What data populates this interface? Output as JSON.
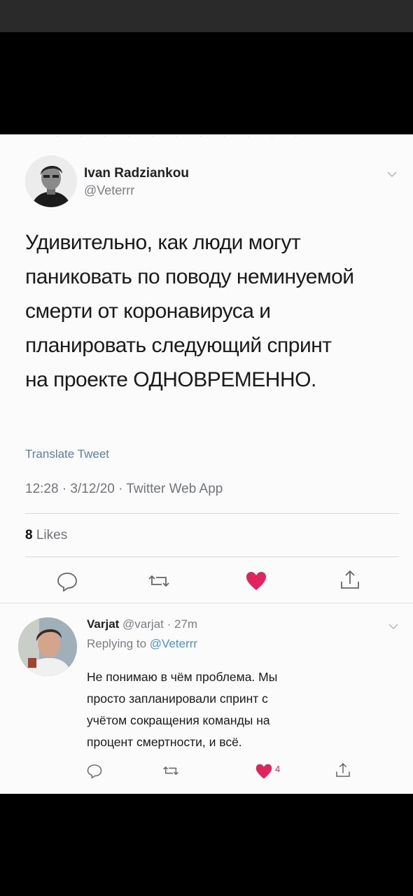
{
  "main_tweet": {
    "author_name": "Ivan Radziankou",
    "author_handle": "@Veterrr",
    "text_lines": [
      "Удивительно, как люди могут",
      "паниковать по поводу неминуемой",
      "смерти от коронавируса и",
      "планировать следующий спринт",
      "на проекте ОДНОВРЕМЕННО."
    ],
    "translate_label": "Translate Tweet",
    "meta": "12:28 · 3/12/20 · Twitter Web App",
    "likes_count": "8",
    "likes_label": "Likes",
    "colors": {
      "like": "#e0245e",
      "link": "#5c7fa3",
      "muted": "#70757a"
    },
    "icons": [
      "reply-icon",
      "retweet-icon",
      "like-icon",
      "share-icon"
    ]
  },
  "reply_tweet": {
    "author_name": "Varjat",
    "author_handle": "@varjat",
    "time": "· 27m",
    "replying_prefix": "Replying to",
    "replying_handle": "@Veterrr",
    "text_lines": [
      "Не понимаю в чём проблема. Мы",
      "просто запланировали спринт с",
      "учётом сокращения команды на",
      "процент смертности, и всё."
    ],
    "like_count": "4",
    "icons": [
      "reply-icon",
      "retweet-icon",
      "like-icon",
      "share-icon"
    ]
  }
}
